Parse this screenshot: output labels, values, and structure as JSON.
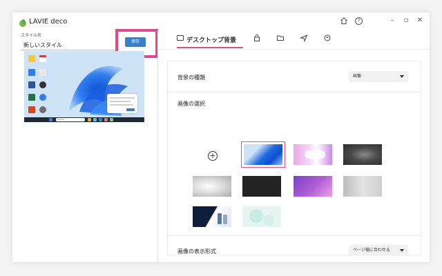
{
  "app": {
    "title": "LAVIE deco",
    "logo_color": "#7cb342"
  },
  "titlebar": {
    "icons": [
      "home-icon",
      "help-icon"
    ],
    "window_controls": [
      "minimize",
      "maximize",
      "close"
    ],
    "help_glyph": "?",
    "minimize_glyph": "–",
    "maximize_glyph": "▫",
    "close_glyph": "✕"
  },
  "style_name": {
    "label": "スタイル名",
    "value": "新しいスタイル"
  },
  "save_button": {
    "label": "保存",
    "color": "#3a80c6",
    "highlight_color": "#e3488b"
  },
  "preview": {
    "search_text": "Search"
  },
  "tabs": [
    {
      "label": "デスクトップ背景",
      "icon": "monitor-icon",
      "active": true
    },
    {
      "label": "",
      "icon": "lock-screen-icon",
      "active": false
    },
    {
      "label": "",
      "icon": "folder-icon",
      "active": false
    },
    {
      "label": "",
      "icon": "send-icon",
      "active": false
    },
    {
      "label": "",
      "icon": "sound-icon",
      "active": false
    }
  ],
  "settings": {
    "background_type": {
      "label": "背景の種類",
      "value": "画像"
    },
    "image_selection": {
      "label": "画像の選択",
      "add_glyph": "+",
      "thumbnails": [
        {
          "name": "windows-bloom-blue",
          "selected": true
        },
        {
          "name": "pink-gradient-orb",
          "selected": false
        },
        {
          "name": "dark-gray-orb",
          "selected": false
        },
        {
          "name": "light-gray-orb",
          "selected": false
        },
        {
          "name": "black-solid",
          "selected": false
        },
        {
          "name": "purple-gradient",
          "selected": false
        },
        {
          "name": "silver-gradient",
          "selected": false
        },
        {
          "name": "dark-diagonal-illustration",
          "selected": false
        },
        {
          "name": "mint-pastel-circles",
          "selected": false
        }
      ]
    },
    "display_format": {
      "label": "画像の表示形式",
      "value": "ページ幅に合わせる"
    }
  },
  "colors": {
    "accent": "#e3488b",
    "primary_blue": "#3a80c6"
  }
}
